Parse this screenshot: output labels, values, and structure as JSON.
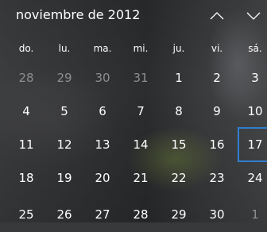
{
  "header": {
    "month_title": "noviembre de 2012",
    "prev_icon": "chevron-up-icon",
    "next_icon": "chevron-down-icon"
  },
  "weekdays": [
    "do.",
    "lu.",
    "ma.",
    "mi.",
    "ju.",
    "vi.",
    "sá."
  ],
  "weeks": [
    [
      {
        "label": "28",
        "current": false,
        "selected": false
      },
      {
        "label": "29",
        "current": false,
        "selected": false
      },
      {
        "label": "30",
        "current": false,
        "selected": false
      },
      {
        "label": "31",
        "current": false,
        "selected": false
      },
      {
        "label": "1",
        "current": true,
        "selected": false
      },
      {
        "label": "2",
        "current": true,
        "selected": false
      },
      {
        "label": "3",
        "current": true,
        "selected": false
      }
    ],
    [
      {
        "label": "4",
        "current": true,
        "selected": false
      },
      {
        "label": "5",
        "current": true,
        "selected": false
      },
      {
        "label": "6",
        "current": true,
        "selected": false
      },
      {
        "label": "7",
        "current": true,
        "selected": false
      },
      {
        "label": "8",
        "current": true,
        "selected": false
      },
      {
        "label": "9",
        "current": true,
        "selected": false
      },
      {
        "label": "10",
        "current": true,
        "selected": false
      }
    ],
    [
      {
        "label": "11",
        "current": true,
        "selected": false
      },
      {
        "label": "12",
        "current": true,
        "selected": false
      },
      {
        "label": "13",
        "current": true,
        "selected": false
      },
      {
        "label": "14",
        "current": true,
        "selected": false
      },
      {
        "label": "15",
        "current": true,
        "selected": false
      },
      {
        "label": "16",
        "current": true,
        "selected": false
      },
      {
        "label": "17",
        "current": true,
        "selected": true
      }
    ],
    [
      {
        "label": "18",
        "current": true,
        "selected": false
      },
      {
        "label": "19",
        "current": true,
        "selected": false
      },
      {
        "label": "20",
        "current": true,
        "selected": false
      },
      {
        "label": "21",
        "current": true,
        "selected": false
      },
      {
        "label": "22",
        "current": true,
        "selected": false
      },
      {
        "label": "23",
        "current": true,
        "selected": false
      },
      {
        "label": "24",
        "current": true,
        "selected": false
      }
    ],
    [
      {
        "label": "25",
        "current": true,
        "selected": false
      },
      {
        "label": "26",
        "current": true,
        "selected": false
      },
      {
        "label": "27",
        "current": true,
        "selected": false
      },
      {
        "label": "28",
        "current": true,
        "selected": false
      },
      {
        "label": "29",
        "current": true,
        "selected": false
      },
      {
        "label": "30",
        "current": true,
        "selected": false
      },
      {
        "label": "1",
        "current": false,
        "selected": false
      }
    ]
  ],
  "colors": {
    "accent": "#2f7fd0",
    "text": "#ffffff",
    "muted_text": "#8d8e90"
  }
}
